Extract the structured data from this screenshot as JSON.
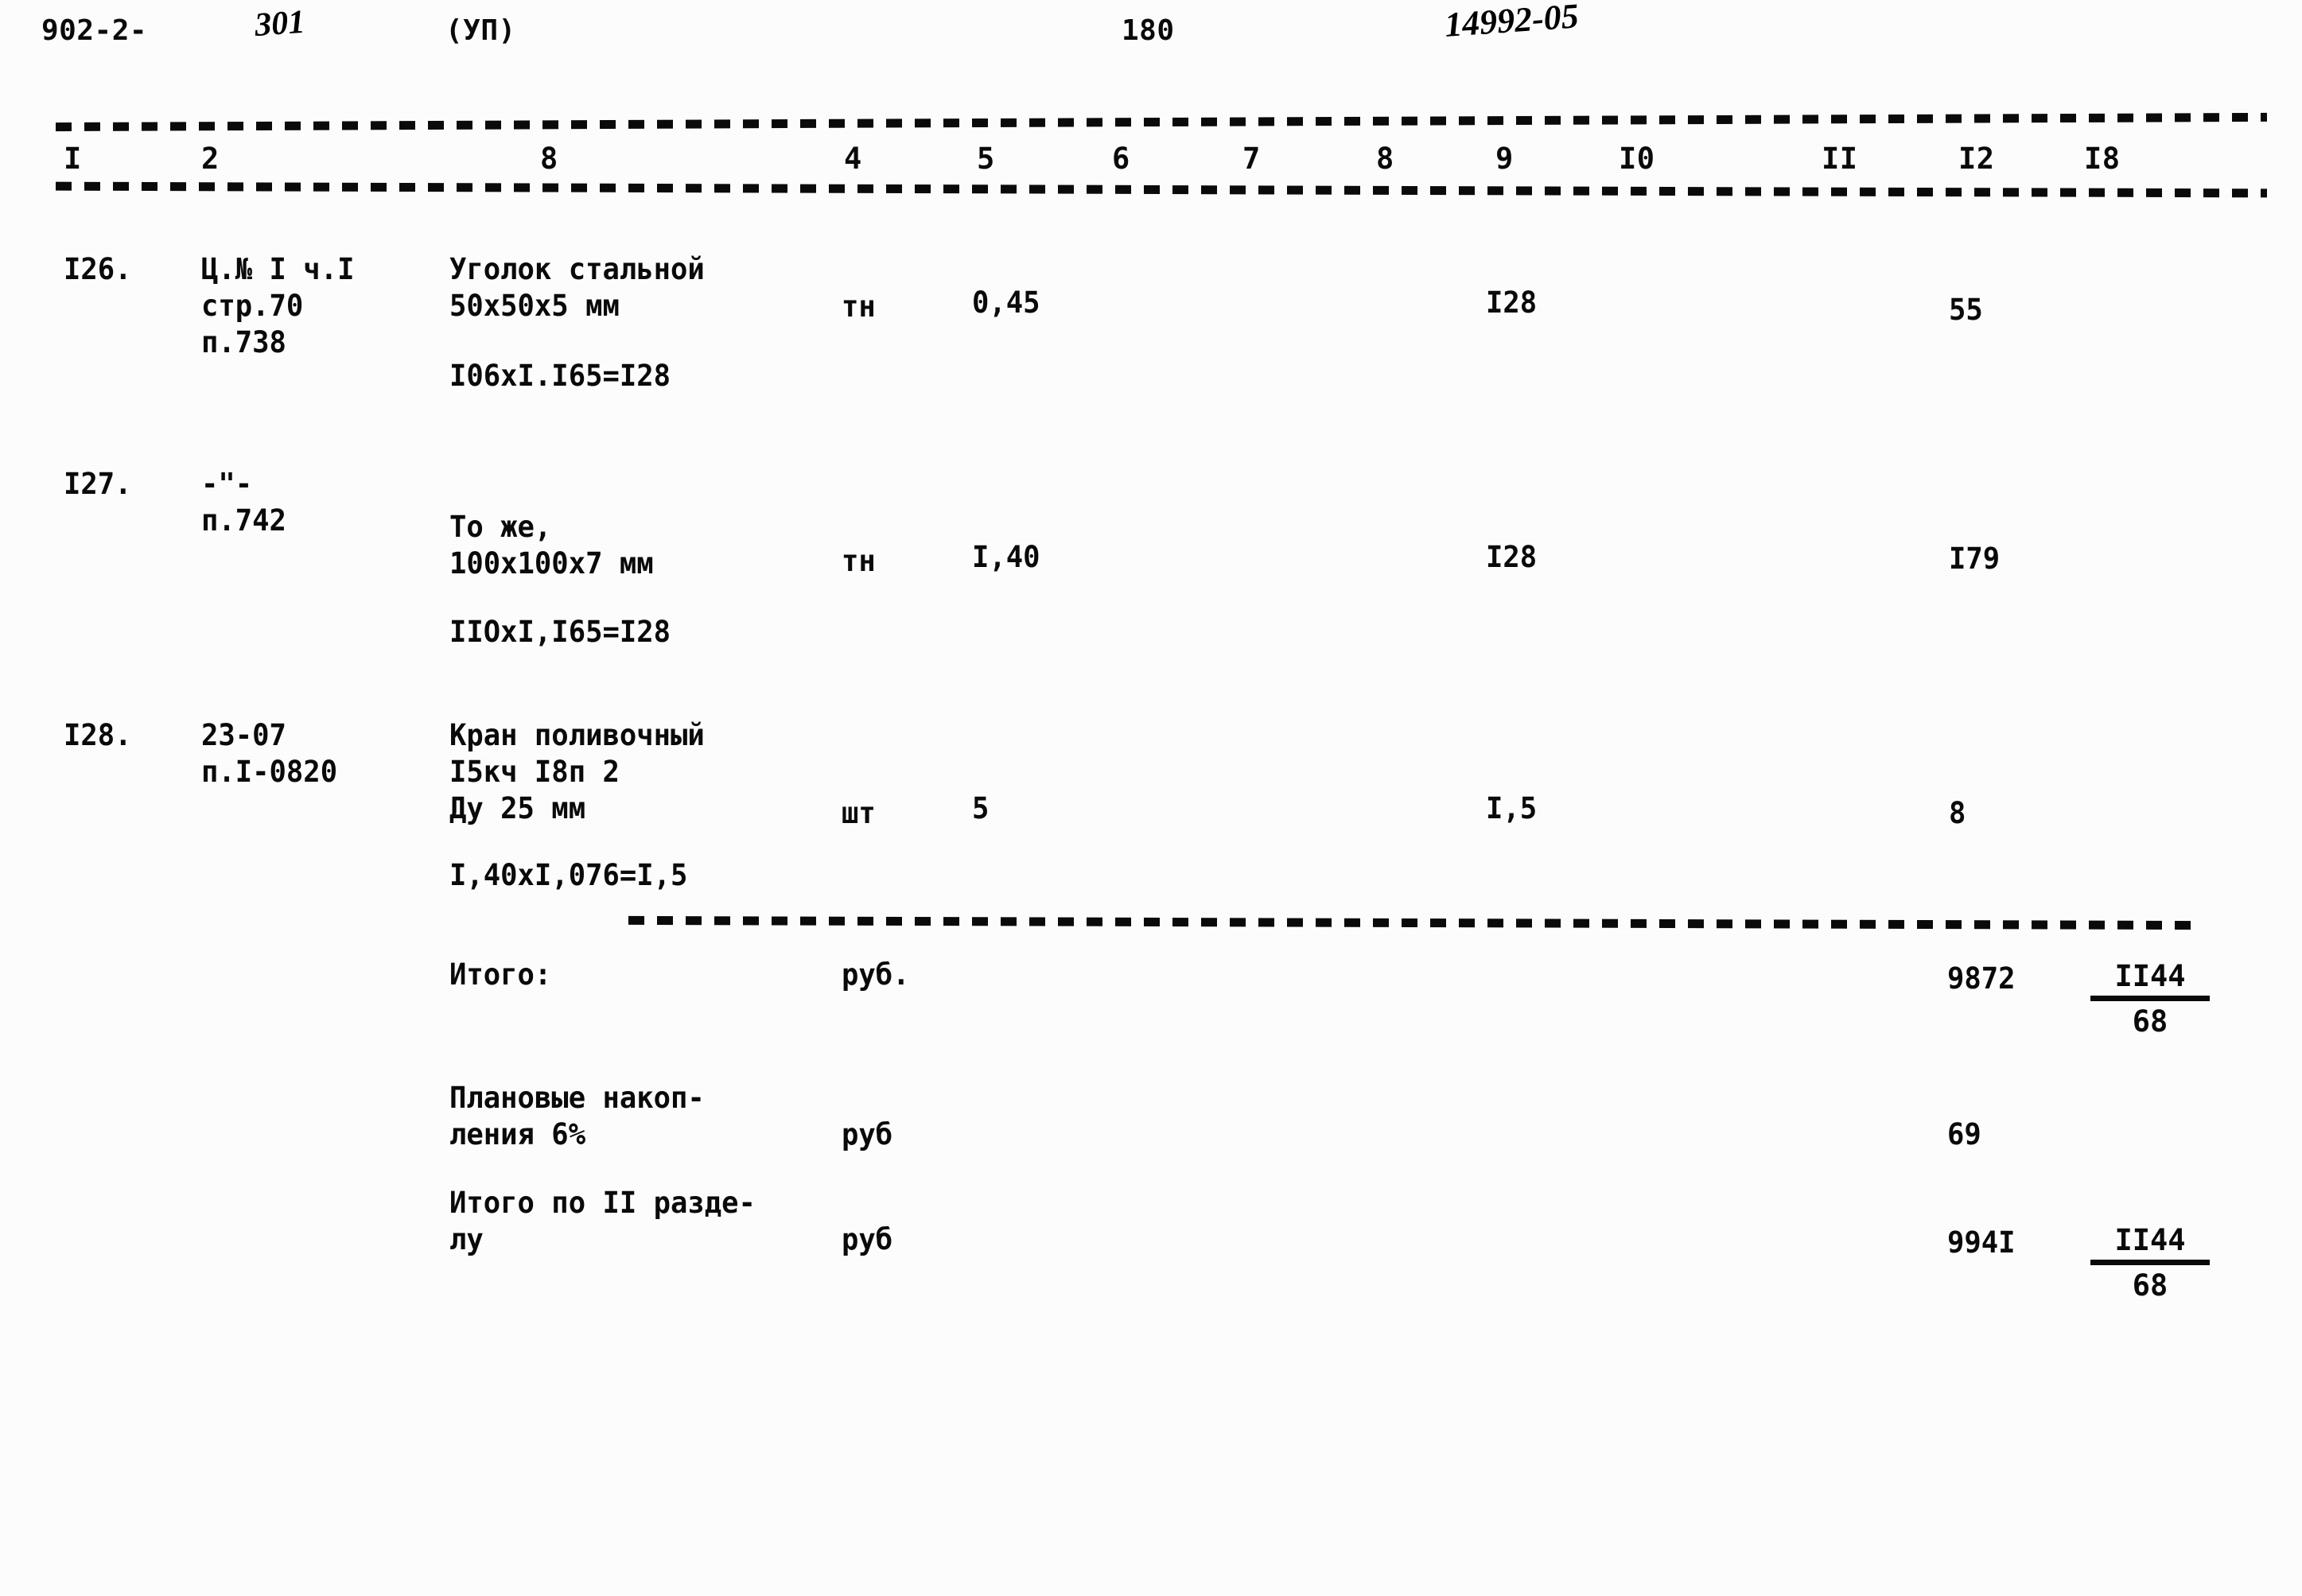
{
  "document": {
    "series_code": "902-2-",
    "handwritten_series_number": "301",
    "section_marker": "(УП)",
    "page_number": "180",
    "handwritten_archive_number": "14992-05"
  },
  "table": {
    "column_headers": [
      "I",
      "2",
      "8",
      "4",
      "5",
      "6",
      "7",
      "8",
      "9",
      "I0",
      "II",
      "I2",
      "I8"
    ],
    "rows": [
      {
        "no": "I26.",
        "justification": "Ц.№ I ч.I\nстр.70\nп.738",
        "description": "Уголок стальной\n50х50х5 мм",
        "calculation": "I06xI.I65=I28",
        "unit": "тн",
        "quantity": "0,45",
        "col9": "I28",
        "col12": "55"
      },
      {
        "no": "I27.",
        "justification": "-\"-\nп.742",
        "description": "То же,\n100х100х7 мм",
        "calculation": "IIOxI,I65=I28",
        "unit": "тн",
        "quantity": "I,40",
        "col9": "I28",
        "col12": "I79"
      },
      {
        "no": "I28.",
        "justification": "23-07\nп.I-0820",
        "description": "Кран поливочный\nI5кч I8п 2\nДу 25 мм",
        "calculation": "I,40xI,076=I,5",
        "unit": "шт",
        "quantity": "5",
        "col9": "I,5",
        "col12": "8"
      }
    ],
    "totals": [
      {
        "label": "Итого:",
        "unit": "руб.",
        "col12": "9872",
        "col13_numerator": "II44",
        "col13_denominator": "68"
      },
      {
        "label": "Плановые накоп-\nления 6%",
        "unit": "руб",
        "col12": "69",
        "col13_numerator": "",
        "col13_denominator": ""
      },
      {
        "label": "Итого по II разде-\nлу",
        "unit": "руб",
        "col12": "994I",
        "col13_numerator": "II44",
        "col13_denominator": "68"
      }
    ]
  }
}
